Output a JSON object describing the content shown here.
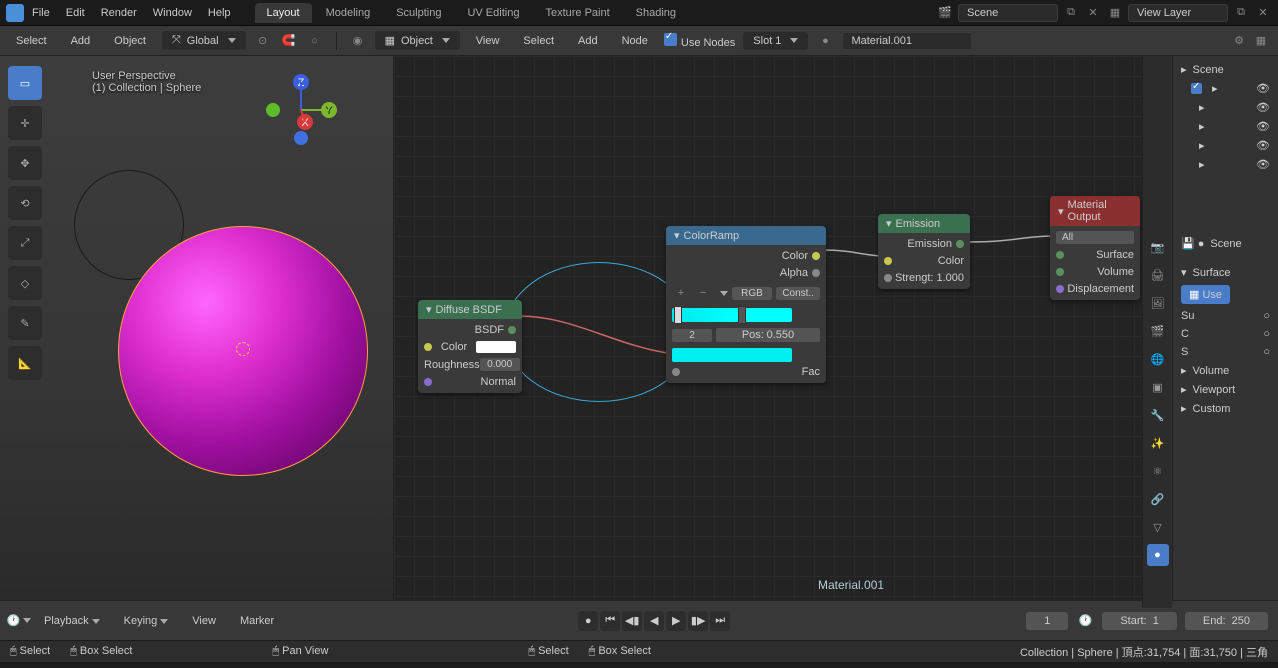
{
  "menu": {
    "file": "File",
    "edit": "Edit",
    "render": "Render",
    "window": "Window",
    "help": "Help"
  },
  "tabs": {
    "layout": "Layout",
    "modeling": "Modeling",
    "sculpting": "Sculpting",
    "uv": "UV Editing",
    "texpaint": "Texture Paint",
    "shading": "Shading"
  },
  "scene": {
    "label": "Scene",
    "viewlayer": "View Layer"
  },
  "toolbar2": {
    "select": "Select",
    "add": "Add",
    "object": "Object",
    "global": "Global",
    "object_mode": "Object",
    "view": "View",
    "select2": "Select",
    "add2": "Add",
    "node": "Node",
    "usenodes": "Use Nodes",
    "slot": "Slot 1",
    "material": "Material.001"
  },
  "viewport": {
    "persp": "User Perspective",
    "coll": "(1) Collection | Sphere"
  },
  "nodes": {
    "diffuse": {
      "title": "Diffuse BSDF",
      "bsdf": "BSDF",
      "color": "Color",
      "roughness": "Roughness",
      "rough_val": "0.000",
      "normal": "Normal"
    },
    "ramp": {
      "title": "ColorRamp",
      "color": "Color",
      "alpha": "Alpha",
      "rgb": "RGB",
      "const": "Const..",
      "stop_num": "2",
      "pos_label": "Pos:",
      "pos_val": "0.550",
      "fac": "Fac"
    },
    "emission": {
      "title": "Emission",
      "emission": "Emission",
      "color": "Color",
      "strength": "Strengt:",
      "str_val": "1.000"
    },
    "output": {
      "title": "Material Output",
      "all": "All",
      "surface": "Surface",
      "volume": "Volume",
      "disp": "Displacement"
    }
  },
  "mat_label": "Material.001",
  "outliner": {
    "scene": "Scene",
    "root": "Scene"
  },
  "props": {
    "surface": "Surface",
    "use": "Use",
    "su": "Su",
    "c": "C",
    "s": "S",
    "volume": "Volume",
    "viewport": "Viewport",
    "custom": "Custom"
  },
  "timeline": {
    "playback": "Playback",
    "keying": "Keying",
    "view": "View",
    "marker": "Marker",
    "frame": "1",
    "start": "Start:",
    "start_v": "1",
    "end": "End:",
    "end_v": "250"
  },
  "status": {
    "select": "Select",
    "box": "Box Select",
    "pan": "Pan View",
    "select2": "Select",
    "box2": "Box Select",
    "stats": "Collection | Sphere | 頂点:31,754 | 面:31,750 | 三角"
  }
}
